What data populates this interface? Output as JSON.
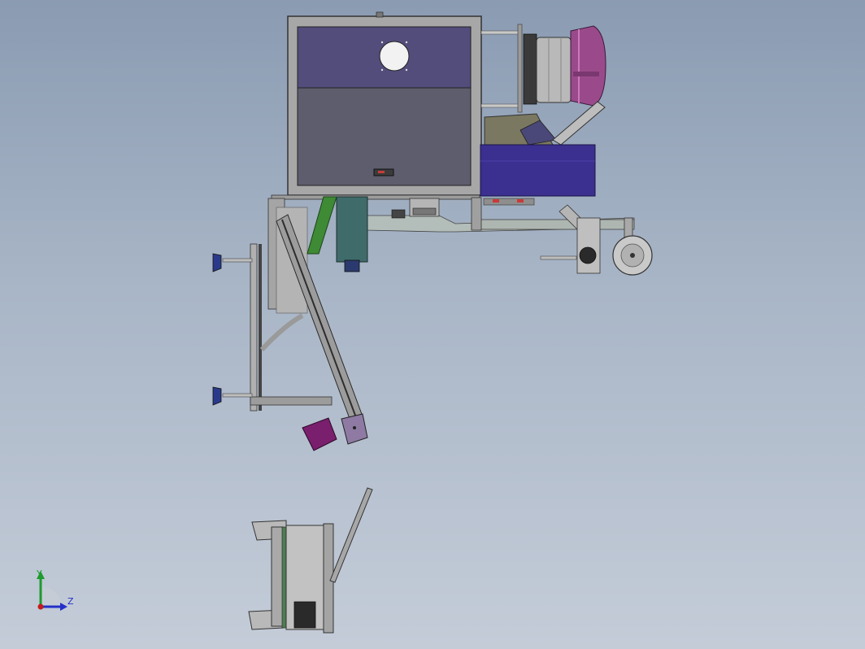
{
  "viewport": {
    "background_top": "#8a9bb2",
    "background_bottom": "#c4ccd8"
  },
  "colors": {
    "frame_gray": "#8e8e8e",
    "panel_purple": "#534d7c",
    "panel_gray": "#5d5d6e",
    "blue_box": "#3b2f8f",
    "magenta_disc": "#9a4a8a",
    "green_chute": "#3f8a35",
    "teal_block": "#3f6b6b",
    "dark_outline": "#2a2a2a"
  },
  "triad": {
    "y_label": "Y",
    "z_label": "Z",
    "y_color": "#1f9a2e",
    "z_color": "#2430c8",
    "origin_color": "#c41a1a"
  },
  "icons": [
    "coordinate-triad-icon"
  ]
}
